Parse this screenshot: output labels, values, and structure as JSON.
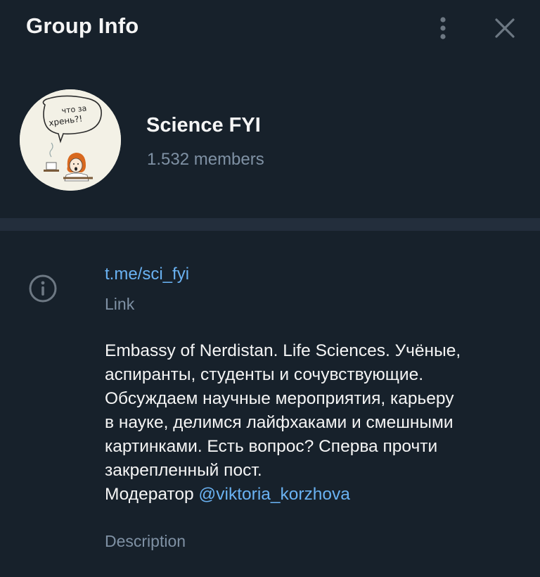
{
  "header": {
    "title": "Group Info",
    "menu_icon": "more-vertical-icon",
    "close_icon": "close-icon"
  },
  "profile": {
    "name": "Science FYI",
    "members": "1.532 members",
    "avatar_text_line1": "что за",
    "avatar_text_line2": "хрень?!"
  },
  "info": {
    "icon": "info-icon",
    "link": "t.me/sci_fyi",
    "link_label": "Link",
    "description": "Embassy of Nerdistan. Life Sciences. Учёные,\nаспиранты, студенты и сочувствующие.\nОбсуждаем научные мероприятия, карьеру\nв науке, делимся лайфхаками и смешными\nкартинками. Есть вопрос? Сперва прочти\nзакрепленный пост.",
    "moderator_prefix": "Модератор ",
    "moderator_mention": "@viktoria_korzhova",
    "description_label": "Description"
  },
  "colors": {
    "background": "#17212b",
    "divider": "#232e3c",
    "accent": "#6ab2f2",
    "secondary_text": "#7f91a4",
    "primary_text": "#f5f5f5"
  }
}
